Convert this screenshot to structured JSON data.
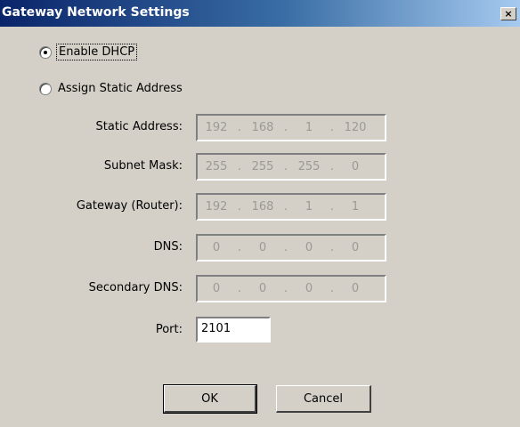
{
  "window": {
    "title": "Gateway Network Settings",
    "close_glyph": "×"
  },
  "options": {
    "dhcp": {
      "label": "Enable DHCP",
      "checked": true
    },
    "static": {
      "label": "Assign Static Address",
      "checked": false
    }
  },
  "fields": {
    "static_address": {
      "label": "Static Address:",
      "octets": [
        "192",
        "168",
        "1",
        "120"
      ]
    },
    "subnet_mask": {
      "label": "Subnet Mask:",
      "octets": [
        "255",
        "255",
        "255",
        "0"
      ]
    },
    "gateway": {
      "label": "Gateway (Router):",
      "octets": [
        "192",
        "168",
        "1",
        "1"
      ]
    },
    "dns": {
      "label": "DNS:",
      "octets": [
        "0",
        "0",
        "0",
        "0"
      ]
    },
    "secondary_dns": {
      "label": "Secondary DNS:",
      "octets": [
        "0",
        "0",
        "0",
        "0"
      ]
    },
    "port": {
      "label": "Port:",
      "value": "2101"
    }
  },
  "buttons": {
    "ok": "OK",
    "cancel": "Cancel"
  },
  "colors": {
    "dialog_bg": "#d4d0c8",
    "title_start": "#0a246a",
    "title_end": "#a6caf0",
    "disabled_text": "#9c9a94"
  }
}
